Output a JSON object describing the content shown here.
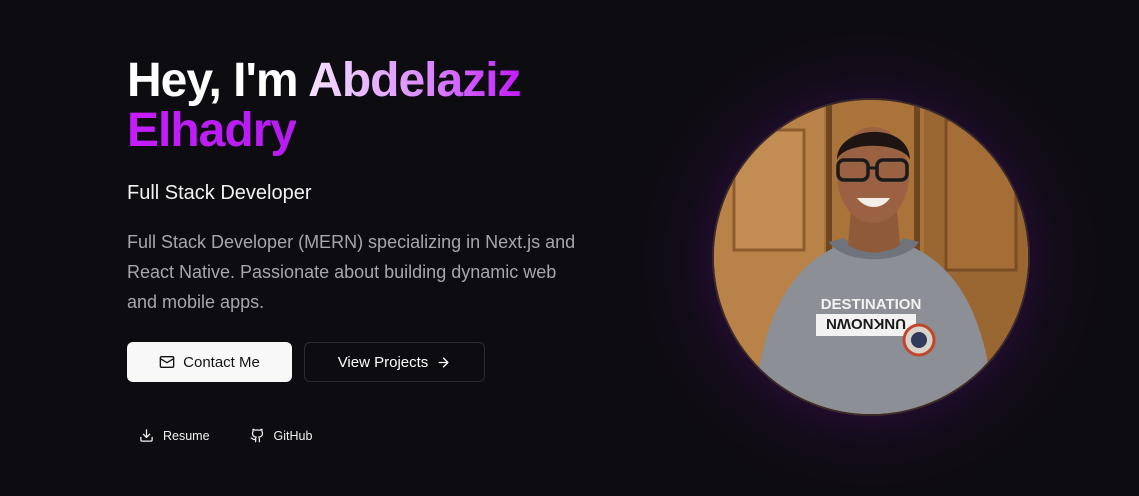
{
  "hero": {
    "greeting": "Hey, I'm ",
    "first_name": "Abdelaziz",
    "last_name": "Elhadry",
    "role": "Full Stack Developer",
    "description": "Full Stack Developer (MERN) specializing in Next.js and React Native. Passionate about building dynamic web and mobile apps.",
    "contact_label": "Contact Me",
    "projects_label": "View Projects",
    "resume_label": "Resume",
    "github_label": "GitHub",
    "shirt_line1": "DESTINATION",
    "shirt_line2": "UNKNOWN"
  },
  "icons": {
    "contact": "mail-icon",
    "projects": "arrow-right-icon",
    "resume": "download-icon",
    "github": "github-icon"
  },
  "colors": {
    "background": "#0d0c10",
    "accent": "#c21aff",
    "glow": "#8a14c0",
    "primary_button": "#f8f8f8",
    "muted_text": "#a7a6ad"
  }
}
